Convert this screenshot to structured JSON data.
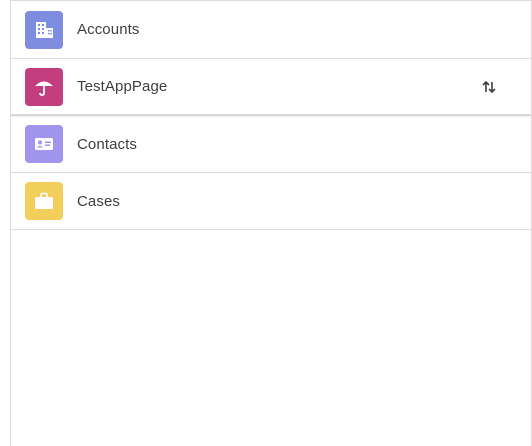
{
  "nav": {
    "items": [
      {
        "label": "Accounts",
        "icon": "accounts-building-icon",
        "color": "#7f8de1"
      },
      {
        "label": "TestAppPage",
        "icon": "umbrella-icon",
        "color": "#c23e7f",
        "reorder_icon": "reorder-arrows-icon"
      },
      {
        "label": "Contacts",
        "icon": "contact-card-icon",
        "color": "#a094ed"
      },
      {
        "label": "Cases",
        "icon": "briefcase-icon",
        "color": "#f2cf5b"
      }
    ]
  }
}
